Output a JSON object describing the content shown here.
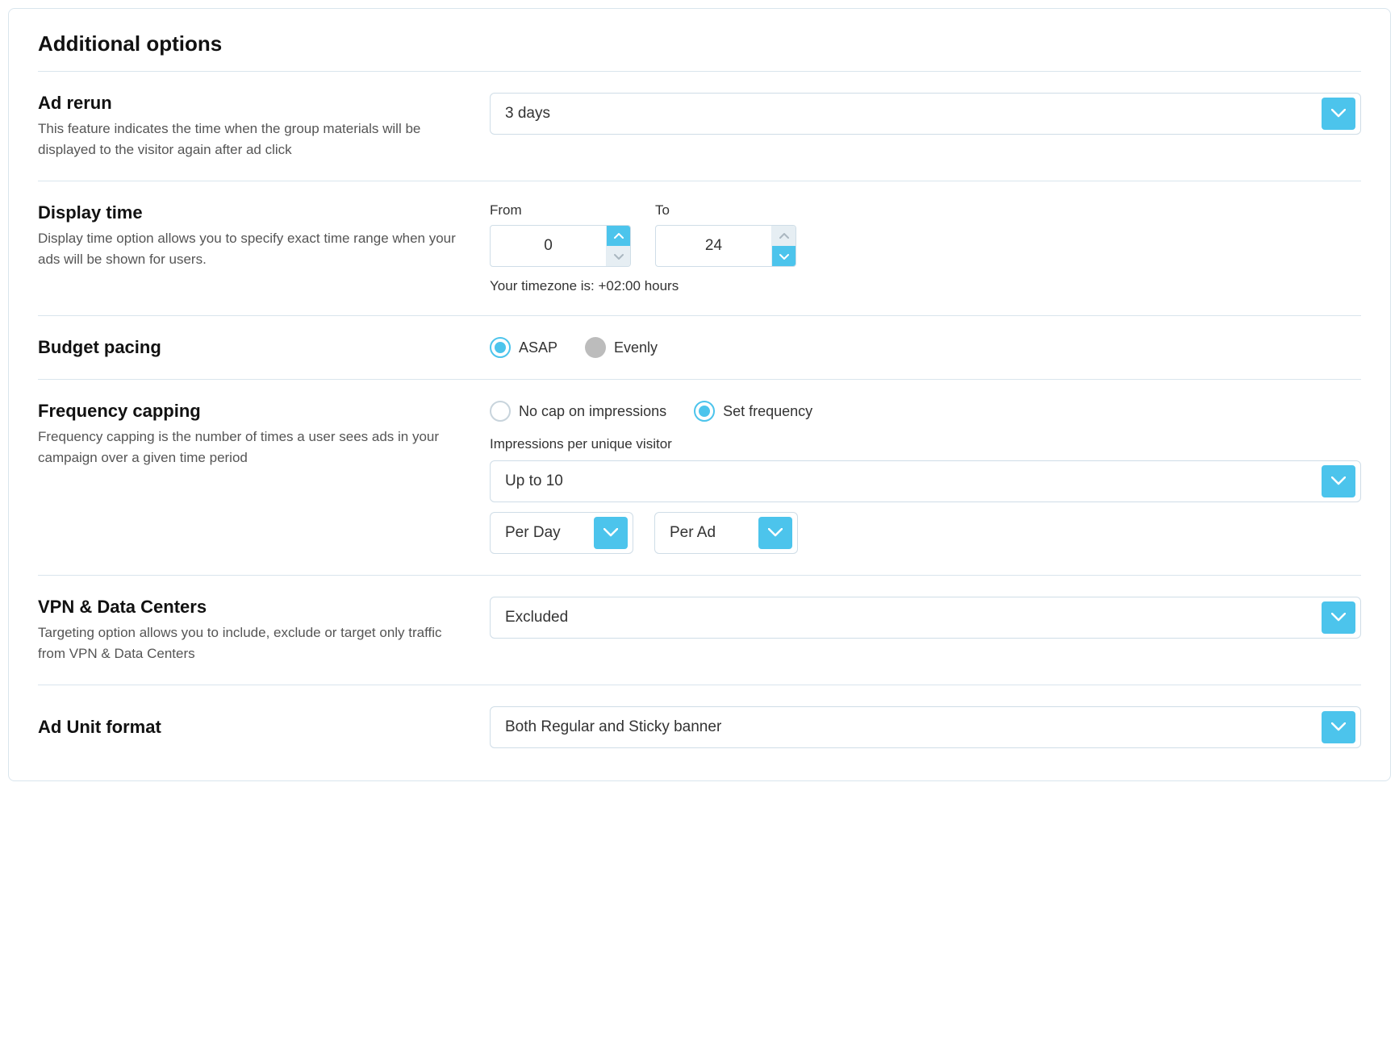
{
  "panel_title": "Additional options",
  "ad_rerun": {
    "title": "Ad rerun",
    "desc": "This feature indicates the time when the group materials will be displayed to the visitor again after ad click",
    "value": "3 days"
  },
  "display_time": {
    "title": "Display time",
    "desc": "Display time option allows you to specify exact time range when your ads will be shown for users.",
    "from_label": "From",
    "to_label": "To",
    "from_value": "0",
    "to_value": "24",
    "tz_note": "Your timezone is: +02:00 hours"
  },
  "budget_pacing": {
    "title": "Budget pacing",
    "asap": "ASAP",
    "evenly": "Evenly"
  },
  "frequency_capping": {
    "title": "Frequency capping",
    "desc": "Frequency capping is the number of times a user sees ads in your campaign over a given time period",
    "no_cap": "No cap on impressions",
    "set_freq": "Set frequency",
    "sub_label": "Impressions per unique visitor",
    "impressions_value": "Up to 10",
    "per_day": "Per Day",
    "per_ad": "Per Ad"
  },
  "vpn_dc": {
    "title": "VPN & Data Centers",
    "desc": "Targeting option allows you to include, exclude or target only traffic from VPN & Data Centers",
    "value": "Excluded"
  },
  "ad_unit": {
    "title": "Ad Unit format",
    "value": "Both Regular and Sticky banner"
  }
}
